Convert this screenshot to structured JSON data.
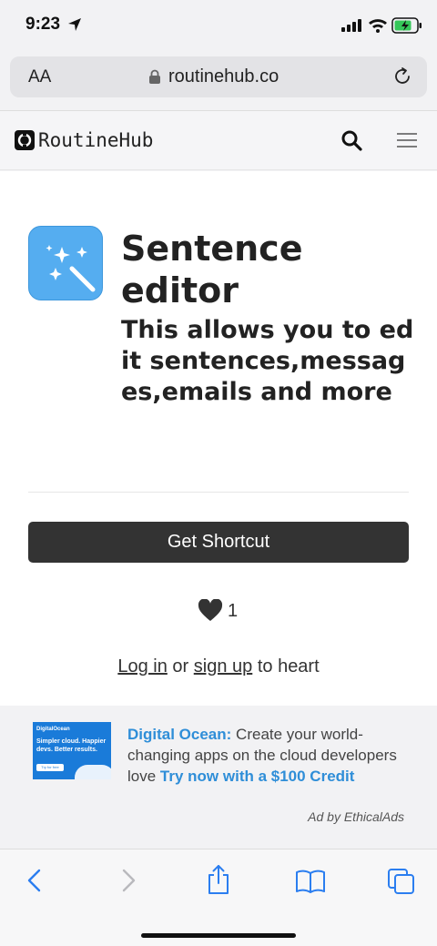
{
  "status": {
    "time": "9:23"
  },
  "browser": {
    "aa_label": "AA",
    "url": "routinehub.co"
  },
  "site": {
    "name": "RoutineHub"
  },
  "shortcut": {
    "title": "Sentence editor",
    "description": "This allows you to edit sentences,messages,emails and more",
    "button_label": "Get Shortcut",
    "heart_count": "1",
    "login_link": "Log in",
    "or_text": "or",
    "signup_link": "sign up",
    "to_heart_text": "to heart"
  },
  "ad": {
    "image": {
      "brand": "DigitalOcean",
      "tagline": "Simpler cloud. Happier devs. Better results.",
      "button": "Try for free"
    },
    "sponsor": "Digital Ocean:",
    "body": "Create your world-changing apps on the cloud developers love",
    "cta": "Try now with a $100 Credit",
    "credit": "Ad by EthicalAds"
  },
  "colors": {
    "accent": "#2f8ed8",
    "app_icon": "#55adf0",
    "button": "#333333",
    "toolbar_icon": "#2b7ef0"
  }
}
